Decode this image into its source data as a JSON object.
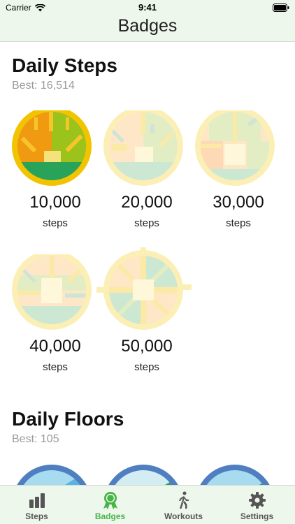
{
  "status_bar": {
    "carrier": "Carrier",
    "time": "9:41"
  },
  "nav": {
    "title": "Badges"
  },
  "sections": {
    "steps": {
      "title": "Daily Steps",
      "best": "Best: 16,514",
      "badges": [
        {
          "value": "10,000",
          "unit": "steps",
          "earned": true
        },
        {
          "value": "20,000",
          "unit": "steps",
          "earned": false
        },
        {
          "value": "30,000",
          "unit": "steps",
          "earned": false
        },
        {
          "value": "40,000",
          "unit": "steps",
          "earned": false
        },
        {
          "value": "50,000",
          "unit": "steps",
          "earned": false
        }
      ]
    },
    "floors": {
      "title": "Daily Floors",
      "best": "Best: 105"
    }
  },
  "tabs": [
    {
      "label": "Steps",
      "icon": "bar-chart-icon",
      "active": false
    },
    {
      "label": "Badges",
      "icon": "ribbon-icon",
      "active": true
    },
    {
      "label": "Workouts",
      "icon": "walking-person-icon",
      "active": false
    },
    {
      "label": "Settings",
      "icon": "gear-icon",
      "active": false
    }
  ],
  "colors": {
    "accent": "#47b447",
    "bar_bg": "#eef7ec",
    "badge_gold": "#f2c400",
    "badge_orange": "#f09a12",
    "badge_green": "#2aa35a",
    "badge_lime": "#9cc21c",
    "floors_blue": "#4f7fc0"
  }
}
